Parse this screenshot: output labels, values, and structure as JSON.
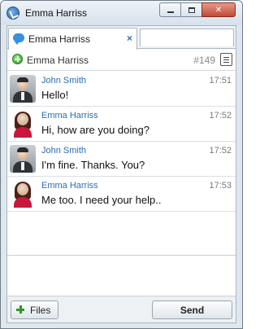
{
  "window": {
    "title": "Emma Harriss"
  },
  "tab": {
    "label": "Emma Harriss",
    "close": "×"
  },
  "contact": {
    "name": "Emma Harriss",
    "ticket": "#149"
  },
  "messages": [
    {
      "sender": "John Smith",
      "time": "17:51",
      "text": "Hello!",
      "avatar": "male"
    },
    {
      "sender": "Emma Harriss",
      "time": "17:52",
      "text": "Hi, how are you doing?",
      "avatar": "female"
    },
    {
      "sender": "John Smith",
      "time": "17:52",
      "text": "I'm fine. Thanks. You?",
      "avatar": "male"
    },
    {
      "sender": "Emma Harriss",
      "time": "17:53",
      "text": "Me too. I need your help..",
      "avatar": "female"
    }
  ],
  "composer": {
    "value": ""
  },
  "toolbar": {
    "files_label": "Files",
    "send_label": "Send"
  },
  "colors": {
    "accent": "#2a6cb4",
    "online": "#2b9b1c",
    "close_button": "#c24a33"
  }
}
